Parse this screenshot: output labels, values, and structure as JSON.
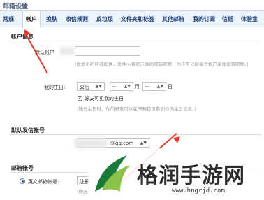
{
  "page": {
    "title": "邮箱设置"
  },
  "tabs": [
    {
      "label": "常规",
      "active": false
    },
    {
      "label": "帐户",
      "active": true
    },
    {
      "label": "换肤",
      "active": false
    },
    {
      "label": "收信规则",
      "active": false
    },
    {
      "label": "反垃圾",
      "active": false
    },
    {
      "label": "文件夹和标签",
      "active": false
    },
    {
      "label": "其他邮箱",
      "active": false
    },
    {
      "label": "我的订阅",
      "active": false
    },
    {
      "label": "信纸",
      "active": false
    },
    {
      "label": "体验室",
      "active": false
    }
  ],
  "account_info": {
    "title": "帐户信息",
    "default_name_label": "默认帐户",
    "default_name_value": "",
    "default_name_hint": "(你发出的所有邮件，发件人将显示你的邮箱昵称，你还可以给每个帐户单独设置昵称。)",
    "birthday_label": "我的生日:",
    "calendar_value": "公历",
    "year_value": "",
    "month_value": "--",
    "month_unit": "月",
    "day_value": "--",
    "day_unit": "日",
    "friends_visible_checked": true,
    "friends_visible_label": "好友可见我的生日",
    "friends_visible_hint": "(快过生日时，你的好友可以在邮箱首页看到你的生日信息。)"
  },
  "default_sender": {
    "title": "默认发信帐号",
    "selected_value": "@qq.com"
  },
  "email_account": {
    "title": "邮箱帐号",
    "english_label": "英文邮箱帐号:",
    "english_button": "注册",
    "english_hint": "(你还可"
  },
  "watermark": {
    "text": "格润手游网",
    "url": "www.hngrjd.com",
    "colors": {
      "dark": "#1b7a3a",
      "light": "#8bc34a"
    }
  },
  "colors": {
    "annotation_arrow": "#e23b2e",
    "tab_bar": "#ebf3fb"
  }
}
